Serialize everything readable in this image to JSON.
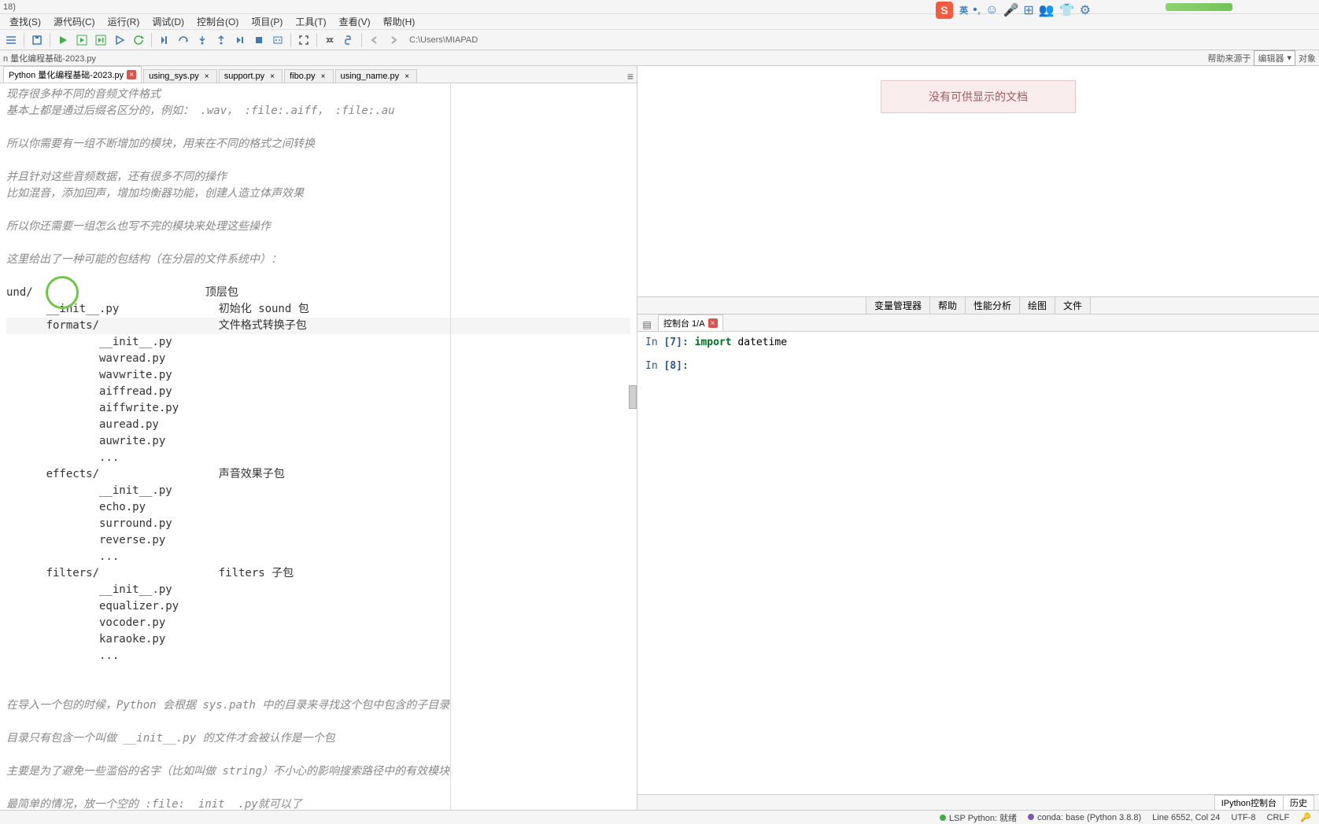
{
  "title": {
    "version": "18)"
  },
  "ime": {
    "logo": "S",
    "lang": "英",
    "glyphs": [
      "•,",
      "☺",
      "🎤",
      "⊞",
      "👥",
      "👕",
      "⚙"
    ]
  },
  "menu": [
    "查找(S)",
    "源代码(C)",
    "运行(R)",
    "调试(D)",
    "控制台(O)",
    "项目(P)",
    "工具(T)",
    "查看(V)",
    "帮助(H)"
  ],
  "toolbar_path": "C:\\Users\\MIAPAD",
  "breadcrumb": "n 量化编程基础-2023.py",
  "help_source": {
    "label": "帮助来源于",
    "combo": "编辑器",
    "obj": "对象"
  },
  "tabs": [
    {
      "label": "Python 量化编程基础-2023.py",
      "modified": true
    },
    {
      "label": "using_sys.py",
      "modified": false
    },
    {
      "label": "support.py",
      "modified": false
    },
    {
      "label": "fibo.py",
      "modified": false
    },
    {
      "label": "using_name.py",
      "modified": false
    }
  ],
  "editor_lines": [
    {
      "t": "现存很多种不同的音频文件格式",
      "s": "c"
    },
    {
      "t": "基本上都是通过后缀名区分的，例如： .wav， :file:.aiff， :file:.au",
      "s": "c"
    },
    {
      "t": "",
      "s": "c"
    },
    {
      "t": "所以你需要有一组不断增加的模块，用来在不同的格式之间转换",
      "s": "c"
    },
    {
      "t": "",
      "s": "c"
    },
    {
      "t": "并且针对这些音频数据，还有很多不同的操作",
      "s": "c"
    },
    {
      "t": "比如混音，添加回声，增加均衡器功能，创建人造立体声效果",
      "s": "c"
    },
    {
      "t": "",
      "s": "c"
    },
    {
      "t": "所以你还需要一组怎么也写不完的模块来处理这些操作",
      "s": "c"
    },
    {
      "t": "",
      "s": "c"
    },
    {
      "t": "这里给出了一种可能的包结构（在分层的文件系统中）：",
      "s": "c"
    },
    {
      "t": "",
      "s": "c"
    },
    {
      "t": "und/                          顶层包",
      "s": "p"
    },
    {
      "t": "      __init__.py               初始化 sound 包",
      "s": "p"
    },
    {
      "t": "      formats/                  文件格式转换子包",
      "s": "hl"
    },
    {
      "t": "              __init__.py",
      "s": "p"
    },
    {
      "t": "              wavread.py",
      "s": "p"
    },
    {
      "t": "              wavwrite.py",
      "s": "p"
    },
    {
      "t": "              aiffread.py",
      "s": "p"
    },
    {
      "t": "              aiffwrite.py",
      "s": "p"
    },
    {
      "t": "              auread.py",
      "s": "p"
    },
    {
      "t": "              auwrite.py",
      "s": "p"
    },
    {
      "t": "              ...",
      "s": "p"
    },
    {
      "t": "      effects/                  声音效果子包",
      "s": "p"
    },
    {
      "t": "              __init__.py",
      "s": "p"
    },
    {
      "t": "              echo.py",
      "s": "p"
    },
    {
      "t": "              surround.py",
      "s": "p"
    },
    {
      "t": "              reverse.py",
      "s": "p"
    },
    {
      "t": "              ...",
      "s": "p"
    },
    {
      "t": "      filters/                  filters 子包",
      "s": "p"
    },
    {
      "t": "              __init__.py",
      "s": "p"
    },
    {
      "t": "              equalizer.py",
      "s": "p"
    },
    {
      "t": "              vocoder.py",
      "s": "p"
    },
    {
      "t": "              karaoke.py",
      "s": "p"
    },
    {
      "t": "              ...",
      "s": "p"
    },
    {
      "t": "",
      "s": "c"
    },
    {
      "t": "",
      "s": "c"
    },
    {
      "t": "在导入一个包的时候，Python 会根据 sys.path 中的目录来寻找这个包中包含的子目录",
      "s": "c"
    },
    {
      "t": "",
      "s": "c"
    },
    {
      "t": "目录只有包含一个叫做 __init__.py 的文件才会被认作是一个包",
      "s": "c"
    },
    {
      "t": "",
      "s": "c"
    },
    {
      "t": "主要是为了避免一些滥俗的名字（比如叫做 string）不小心的影响搜索路径中的有效模块",
      "s": "c"
    },
    {
      "t": "",
      "s": "c"
    },
    {
      "t": "最简单的情况，放一个空的 :file:__init__.py就可以了",
      "s": "c"
    }
  ],
  "help_panel": {
    "no_doc": "没有可供显示的文档"
  },
  "help_tabs": [
    "变量管理器",
    "帮助",
    "性能分析",
    "绘图",
    "文件"
  ],
  "console": {
    "tab": "控制台 1/A",
    "in7": {
      "prompt": "In ",
      "num": "[7]:",
      "kw": "import",
      "rest": " datetime"
    },
    "in8": {
      "prompt": "In ",
      "num": "[8]:"
    },
    "bottom_tabs": [
      "IPython控制台",
      "历史"
    ]
  },
  "status": {
    "lsp": "LSP Python: 就绪",
    "conda": "conda: base (Python 3.8.8)",
    "line": "Line 6552, Col 24",
    "enc": "UTF-8",
    "eol": "CRLF"
  }
}
